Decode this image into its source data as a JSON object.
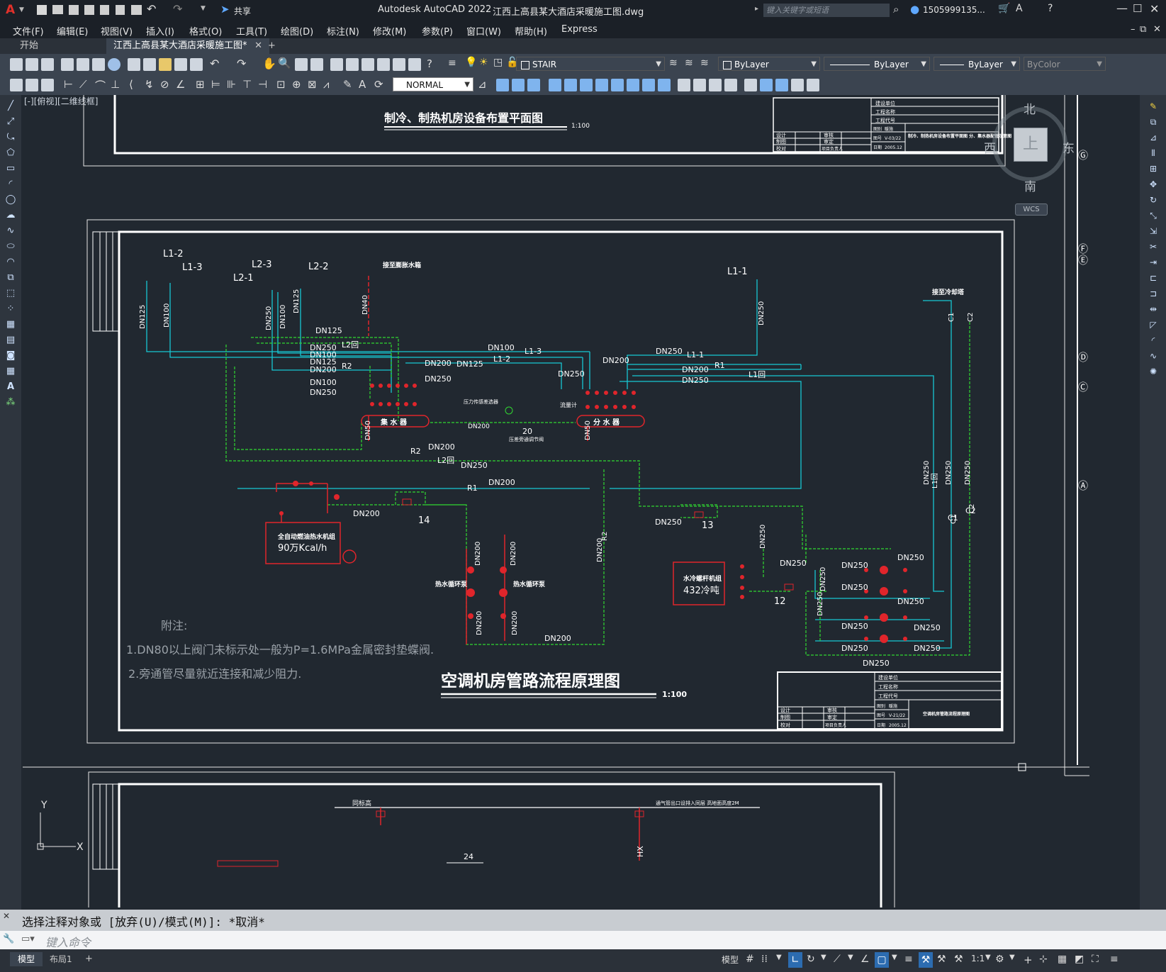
{
  "titlebar": {
    "app_title": "Autodesk AutoCAD 2022",
    "file_title": "江西上高县某大酒店采暖施工图.dwg",
    "share_label": "共享",
    "search_placeholder": "键入关键字或短语",
    "user": "1505999135..."
  },
  "menu": [
    "文件(F)",
    "编辑(E)",
    "视图(V)",
    "插入(I)",
    "格式(O)",
    "工具(T)",
    "绘图(D)",
    "标注(N)",
    "修改(M)",
    "参数(P)",
    "窗口(W)",
    "帮助(H)",
    "Express"
  ],
  "tabs": {
    "start": "开始",
    "document": "江西上高县某大酒店采暖施工图*",
    "new_tab": "+"
  },
  "toolbar": {
    "layer": "STAIR",
    "color": "ByLayer",
    "linetype": "ByLayer",
    "lineweight": "ByLayer",
    "plotstyle": "ByColor",
    "dimstyle": "NORMAL"
  },
  "viewport_label": "[-][俯视][二维线框]",
  "viewcube": {
    "north": "北",
    "south": "南",
    "east": "东",
    "west": "西",
    "top": "上",
    "wcs": "WCS"
  },
  "drawing": {
    "top_title": "制冷、制热机房设备布置平面图",
    "top_scale": "1:100",
    "main_title": "空调机房管路流程原理图",
    "main_scale": "1:100",
    "note_header": "附注:",
    "note1": "1.DN80以上阀门未标示处一般为P=1.6MPa金属密封垫蝶阀.",
    "note2": "2.旁通管尽量就近连接和减少阻力.",
    "collector_label": "集 水 器",
    "distributor_label": "分 水 器",
    "boiler_label": "全自动燃油热水机组",
    "boiler_capacity": "90万Kcal/h",
    "chiller_label": "水冷螺杆机组",
    "chiller_capacity": "432冷吨",
    "pump_left": "热水循环泵",
    "pump_right": "热水循环泵",
    "to_expansion": "接至膨胀水箱",
    "to_cooling_tower": "接至冷却塔",
    "diff_valve": "压力传感差选器",
    "auto_valve": "压差旁通调节阀",
    "flowmeter": "流量计",
    "pipe_labels": [
      "L1-2",
      "L1-3",
      "L2-3",
      "L2-1",
      "L2-2",
      "L1-1",
      "DN125",
      "DN100",
      "DN250",
      "DN40",
      "DN200",
      "R2",
      "R1",
      "L2回",
      "L1回",
      "DN50",
      "C1",
      "C2",
      "12",
      "13",
      "14",
      "20"
    ],
    "tb_rows": [
      "建设单位",
      "工程名称",
      "工程代号",
      "设计",
      "审核",
      "制图",
      "审定",
      "校对",
      "项目负责人",
      "图别",
      "暖施",
      "图号",
      "日期"
    ],
    "tb_top_no": "V-03/22",
    "tb_top_date": "2005.12",
    "tb_top_name": "制冷、制热机房设备布置平面图 分、集水器配管示意图",
    "tb_main_no": "V-21/22",
    "tb_main_date": "2005.12",
    "tb_main_name": "空调机房管路流程原理图",
    "bottom_labels": [
      "同标高",
      "24",
      "HX",
      "通气管出口设排入同层 高地面高度2M"
    ]
  },
  "ucs": {
    "x": "X",
    "y": "Y"
  },
  "command": {
    "history": "选择注释对象或 [放弃(U)/模式(M)]: *取消*",
    "placeholder": "键入命令"
  },
  "status": {
    "model_tab": "模型",
    "layout_tab": "布局1",
    "add": "+",
    "model_btn": "模型",
    "scale": "1:1"
  }
}
